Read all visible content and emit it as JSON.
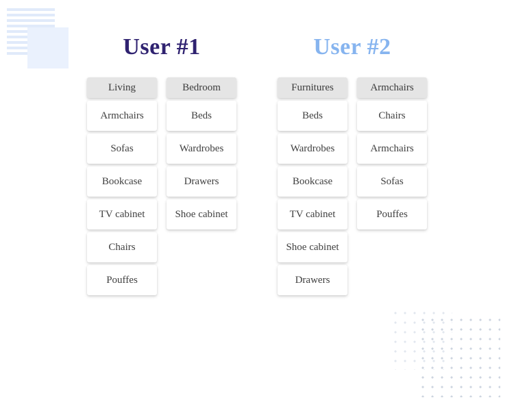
{
  "users": [
    {
      "title": "User #1",
      "headingClass": "heading-purple",
      "columns": [
        {
          "header": "Living",
          "items": [
            "Armchairs",
            "Sofas",
            "Bookcase",
            "TV cabinet",
            "Chairs",
            "Pouffes"
          ]
        },
        {
          "header": "Bedroom",
          "items": [
            "Beds",
            "Wardrobes",
            "Drawers",
            "Shoe cabinet"
          ]
        }
      ]
    },
    {
      "title": "User #2",
      "headingClass": "heading-blue",
      "columns": [
        {
          "header": "Furnitures",
          "items": [
            "Beds",
            "Wardrobes",
            "Bookcase",
            "TV cabinet",
            "Shoe cabinet",
            "Drawers"
          ]
        },
        {
          "header": "Armchairs",
          "items": [
            "Chairs",
            "Armchairs",
            "Sofas",
            "Pouffes"
          ]
        }
      ]
    }
  ]
}
